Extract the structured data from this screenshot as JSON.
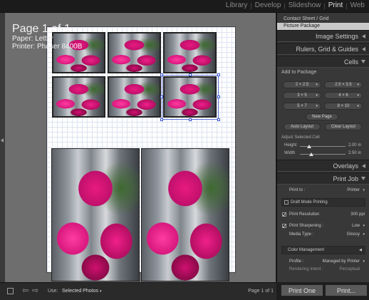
{
  "modules": [
    "Library",
    "Develop",
    "Slideshow",
    "Print",
    "Web"
  ],
  "active_module": "Print",
  "page_info": {
    "title": "Page 1 of 1",
    "paper": "Paper: Letter",
    "printer": "Printer: Phaser 8400B"
  },
  "templates": {
    "items": [
      "Contact Sheet / Grid",
      "Picture Package"
    ],
    "selected": "Picture Package"
  },
  "sections": {
    "image_settings": "Image Settings",
    "rulers": "Rulers, Grid & Guides",
    "cells": "Cells",
    "overlays": "Overlays",
    "print_job": "Print Job"
  },
  "cells": {
    "add_to_package": "Add to Package",
    "sizes": [
      "2 × 2.5",
      "2.5 × 3.5",
      "3 × 5",
      "4 × 6",
      "5 × 7",
      "8 × 10"
    ],
    "new_page": "New Page",
    "auto_layout": "Auto Layout",
    "clear_layout": "Clear Layout",
    "adjust_selected": "Adjust Selected Cell",
    "height_label": "Height",
    "height_value": "2.00",
    "height_unit": "in",
    "width_label": "Width",
    "width_value": "2.50",
    "width_unit": "in",
    "height_fraction": 0.2,
    "width_fraction": 0.25
  },
  "print_job": {
    "print_to_label": "Print to :",
    "print_to_value": "Printer",
    "draft_mode": "Draft Mode Printing",
    "draft_mode_checked": false,
    "print_resolution_label": "Print Resolution",
    "print_resolution_value": "300",
    "print_resolution_unit": "ppi",
    "print_resolution_checked": true,
    "print_sharpening_label": "Print Sharpening :",
    "print_sharpening_value": "Low",
    "print_sharpening_checked": true,
    "media_type_label": "Media Type :",
    "media_type_value": "Glossy",
    "color_management": "Color Management",
    "profile_label": "Profile :",
    "profile_value": "Managed by Printer",
    "rendering_intent_label": "Rendering Intent :",
    "rendering_intent_value": "Perceptual"
  },
  "buttons": {
    "print_one": "Print One",
    "print": "Print..."
  },
  "toolbar": {
    "use_label": "Use:",
    "use_value": "Selected Photos",
    "page_count": "Page 1 of 1"
  }
}
